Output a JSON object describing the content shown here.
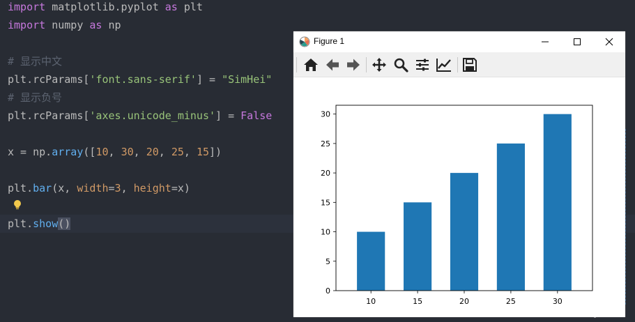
{
  "code": {
    "line1": {
      "kw1": "import",
      "mod": " matplotlib.pyplot ",
      "kw2": "as",
      "alias": " plt"
    },
    "line2": {
      "kw1": "import",
      "mod": " numpy ",
      "kw2": "as",
      "alias": " np"
    },
    "line4": {
      "comment": "# 显示中文"
    },
    "line5": {
      "a": "plt.rcParams[",
      "b": "'font.sans-serif'",
      "c": "] = ",
      "d": "\"SimHei\""
    },
    "line6": {
      "comment": "# 显示负号"
    },
    "line7": {
      "a": "plt.rcParams[",
      "b": "'axes.unicode_minus'",
      "c": "] = ",
      "d": "False"
    },
    "line9": {
      "a": "x = np.",
      "b": "array",
      "c": "([",
      "n1": "10",
      "s1": ", ",
      "n2": "30",
      "s2": ", ",
      "n3": "20",
      "s3": ", ",
      "n4": "25",
      "s4": ", ",
      "n5": "15",
      "e": "])"
    },
    "line11": {
      "a": "plt.",
      "b": "bar",
      "c": "(x, ",
      "p1": "width",
      "d": "=",
      "n1": "3",
      "e": ", ",
      "p2": "height",
      "f": "=x)"
    },
    "line13": {
      "a": "plt.",
      "b": "show",
      "c": "(",
      "d": ")"
    }
  },
  "figure": {
    "title": "Figure 1",
    "toolbar": [
      "home-icon",
      "back-icon",
      "forward-icon",
      "pan-icon",
      "zoom-icon",
      "configure-subplots-icon",
      "edit-axis-icon",
      "save-icon"
    ]
  },
  "chart_data": {
    "type": "bar",
    "x": [
      10,
      30,
      20,
      25,
      15
    ],
    "values": [
      10,
      30,
      20,
      25,
      15
    ],
    "bar_width": 3,
    "color": "#1f77b4",
    "xticks": [
      10,
      15,
      20,
      25,
      30
    ],
    "yticks": [
      0,
      5,
      10,
      15,
      20,
      25,
      30
    ],
    "xlim": [
      6.25,
      33.75
    ],
    "ylim": [
      0,
      31.5
    ],
    "title": "",
    "xlabel": "",
    "ylabel": "",
    "grid": false
  },
  "watermark": "CSDN @serenity宁静"
}
